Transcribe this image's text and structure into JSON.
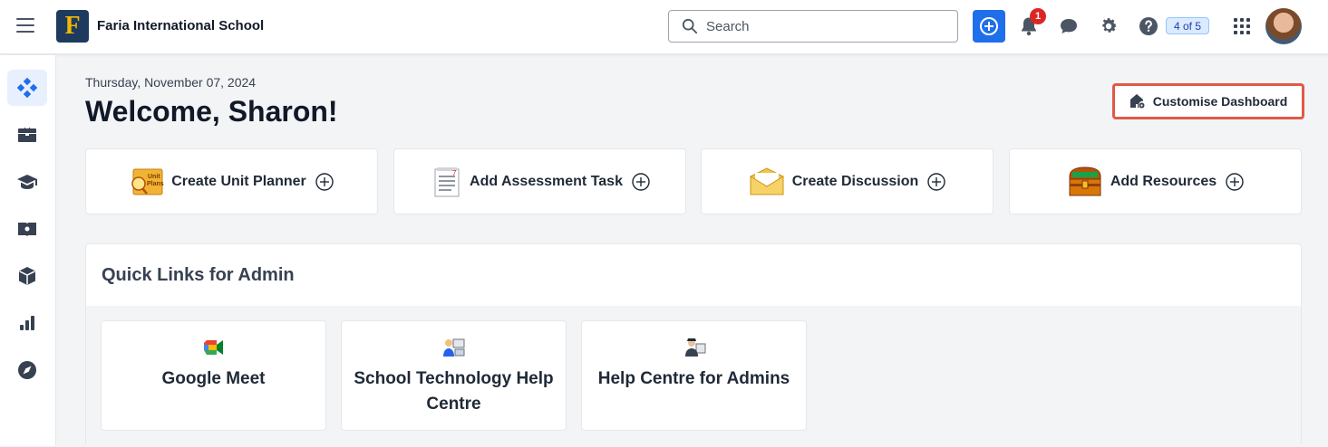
{
  "header": {
    "school_name": "Faria International School",
    "logo_letter": "F",
    "search_placeholder": "Search",
    "notification_count": "1",
    "pager": "4 of 5"
  },
  "sidebar": {
    "items": [
      {
        "icon": "dashboard-icon",
        "active": true
      },
      {
        "icon": "briefcase-icon"
      },
      {
        "icon": "graduation-cap-icon"
      },
      {
        "icon": "reports-icon"
      },
      {
        "icon": "box-icon"
      },
      {
        "icon": "bar-chart-icon"
      },
      {
        "icon": "compass-icon"
      }
    ]
  },
  "main": {
    "date": "Thursday, November 07, 2024",
    "welcome": "Welcome, Sharon!",
    "customise_label": "Customise Dashboard",
    "actions": [
      {
        "label": "Create Unit Planner",
        "icon": "unit-planner-icon"
      },
      {
        "label": "Add Assessment Task",
        "icon": "assessment-task-icon"
      },
      {
        "label": "Create Discussion",
        "icon": "envelope-icon"
      },
      {
        "label": "Add Resources",
        "icon": "treasure-chest-icon"
      }
    ],
    "quick_links": {
      "title": "Quick Links for Admin",
      "items": [
        {
          "label": "Google Meet",
          "icon": "google-meet-icon"
        },
        {
          "label": "School Technology Help Centre",
          "icon": "tech-help-icon"
        },
        {
          "label": "Help Centre for Admins",
          "icon": "admin-help-icon"
        }
      ]
    }
  },
  "colors": {
    "accent": "#1f6feb",
    "highlight_border": "#e05a47",
    "badge": "#dc2626"
  }
}
